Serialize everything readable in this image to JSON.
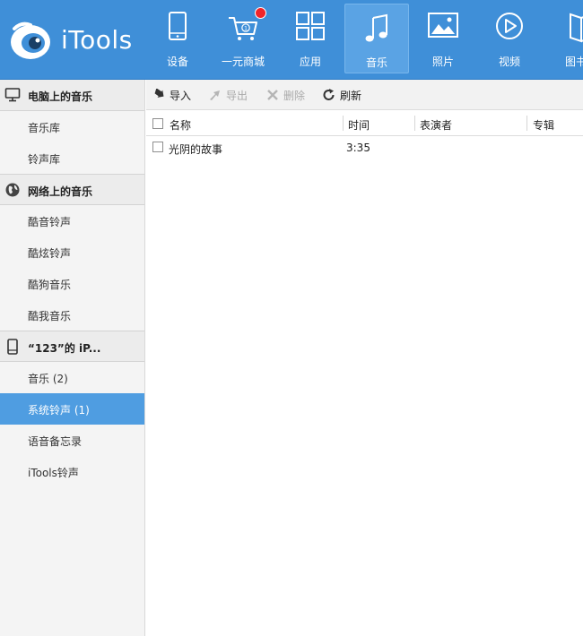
{
  "app": {
    "logo_text": "iTools"
  },
  "nav": {
    "items": [
      {
        "label": "设备",
        "icon": "phone-icon"
      },
      {
        "label": "一元商城",
        "icon": "cart-icon",
        "badge": true
      },
      {
        "label": "应用",
        "icon": "apps-grid-icon"
      },
      {
        "label": "音乐",
        "icon": "music-note-icon",
        "active": true
      },
      {
        "label": "照片",
        "icon": "picture-icon"
      },
      {
        "label": "视频",
        "icon": "play-icon"
      },
      {
        "label": "图书",
        "icon": "book-icon"
      }
    ]
  },
  "sidebar": {
    "groups": [
      {
        "label": "电脑上的音乐",
        "icon": "monitor-icon",
        "items": [
          "音乐库",
          "铃声库"
        ]
      },
      {
        "label": "网络上的音乐",
        "icon": "globe-icon",
        "items": [
          "酷音铃声",
          "酷炫铃声",
          "酷狗音乐",
          "酷我音乐"
        ]
      },
      {
        "label": "“123”的 iP...",
        "icon": "device-icon",
        "items": [
          "音乐 (2)",
          "系统铃声 (1)",
          "语音备忘录",
          "iTools铃声"
        ]
      }
    ],
    "selected": "系统铃声 (1)"
  },
  "toolbar": {
    "import_label": "导入",
    "export_label": "导出",
    "delete_label": "删除",
    "refresh_label": "刷新"
  },
  "table": {
    "columns": [
      "名称",
      "时间",
      "表演者",
      "专辑"
    ],
    "rows": [
      {
        "name": "光阴的故事",
        "time": "3:35",
        "artist": "",
        "album": ""
      }
    ]
  },
  "colors": {
    "header": "#3f8fd8",
    "selected": "#4f9de1",
    "badge": "#f0242a"
  }
}
